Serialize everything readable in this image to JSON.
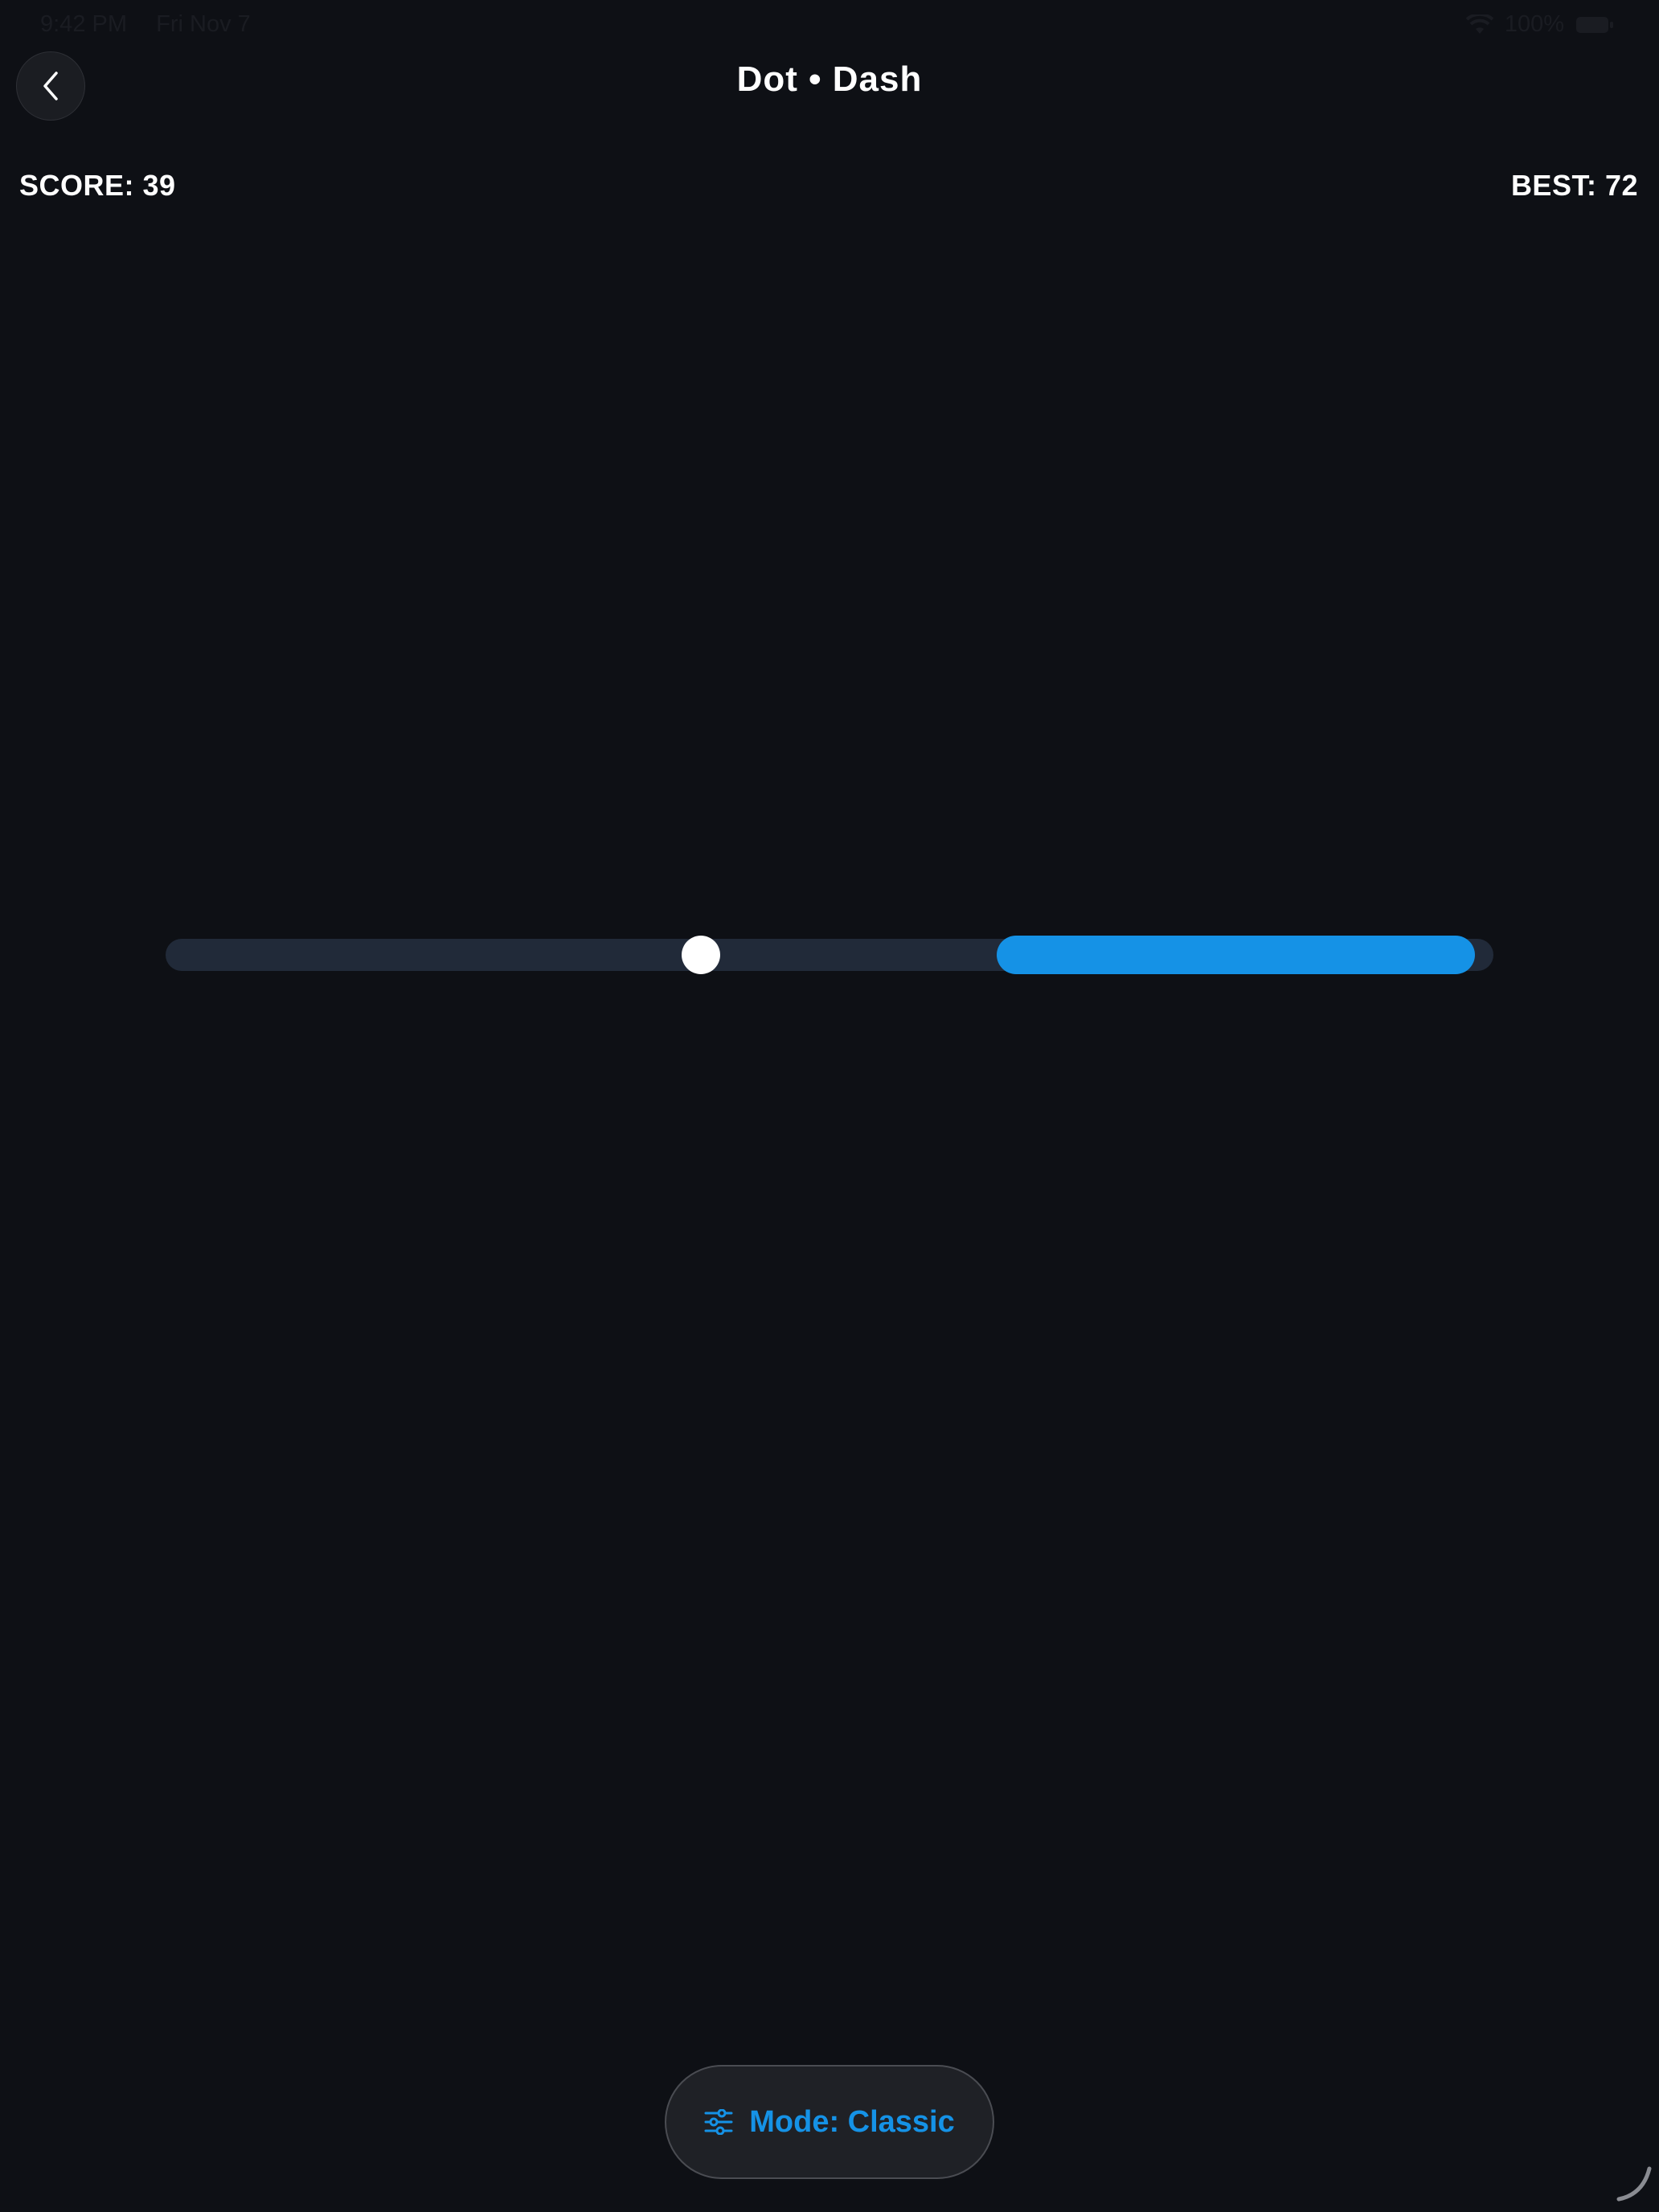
{
  "status_bar": {
    "time": "9:42 PM",
    "date": "Fri Nov 7",
    "battery": "100%",
    "wifi_icon": "wifi-icon",
    "battery_icon": "battery-icon"
  },
  "nav": {
    "title": "Dot • Dash",
    "back_icon": "chevron-left-icon"
  },
  "scoreboard": {
    "score_text": "SCORE: 39",
    "best_text": "BEST: 72",
    "score": 39,
    "best": 72
  },
  "game": {
    "dot_position": 0.403,
    "dash_start": 0.626,
    "dash_end": 0.986,
    "colors": {
      "background": "#0e1015",
      "track": "#212a39",
      "dash": "#1592e6",
      "dot": "#ffffff"
    }
  },
  "mode_button": {
    "label": "Mode: Classic",
    "icon": "sliders-icon",
    "accent": "#1592e6"
  }
}
